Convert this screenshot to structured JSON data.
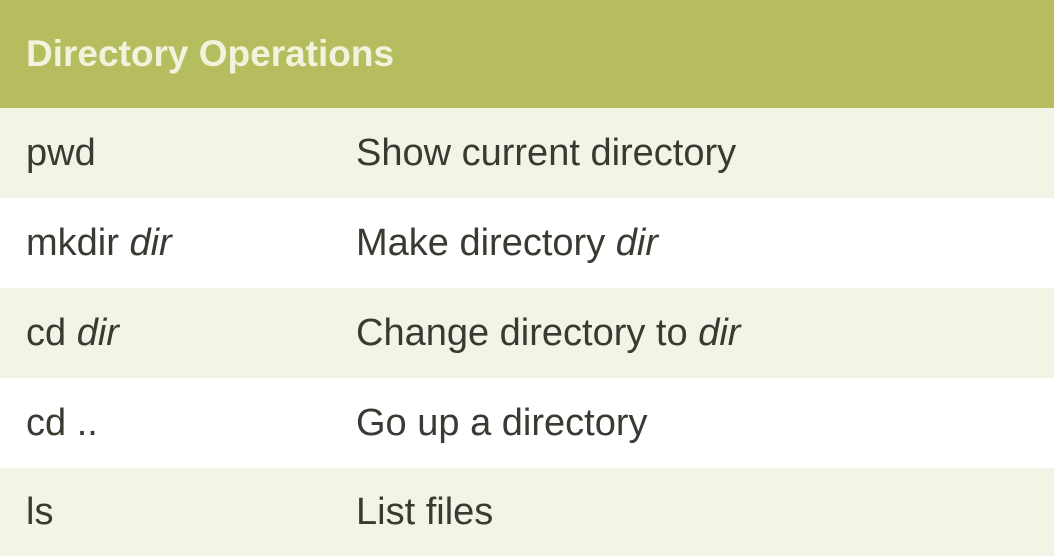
{
  "table": {
    "title": "Directory Operations",
    "header_color": "#b5bd5f",
    "rows": [
      {
        "command": {
          "text": "pwd",
          "arg": ""
        },
        "description": {
          "text": "Show current directory",
          "arg": ""
        }
      },
      {
        "command": {
          "text": "mkdir ",
          "arg": "dir"
        },
        "description": {
          "text": "Make directory ",
          "arg": "dir"
        }
      },
      {
        "command": {
          "text": "cd ",
          "arg": "dir"
        },
        "description": {
          "text": "Change directory to ",
          "arg": "dir"
        }
      },
      {
        "command": {
          "text": "cd ..",
          "arg": ""
        },
        "description": {
          "text": "Go up a directory",
          "arg": ""
        }
      },
      {
        "command": {
          "text": "ls",
          "arg": ""
        },
        "description": {
          "text": "List files",
          "arg": ""
        }
      }
    ]
  }
}
